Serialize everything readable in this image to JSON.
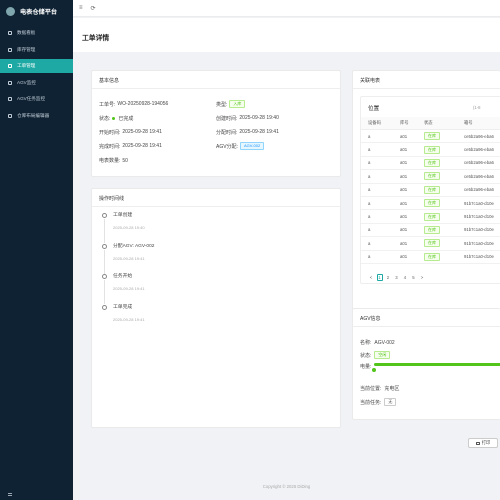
{
  "app": {
    "title": "电表仓储平台"
  },
  "sidebar": {
    "items": [
      {
        "label": "数据看板",
        "icon": "dashboard-icon",
        "active": false
      },
      {
        "label": "库存管理",
        "icon": "inventory-icon",
        "active": false
      },
      {
        "label": "工单管理",
        "icon": "workorder-icon",
        "active": true
      },
      {
        "label": "AGV监控",
        "icon": "agv-icon",
        "active": false
      },
      {
        "label": "AGV任务监控",
        "icon": "task-icon",
        "active": false
      },
      {
        "label": "仓库布局编辑器",
        "icon": "layout-icon",
        "active": false
      }
    ]
  },
  "topbar": {
    "menu_icon": "≡",
    "refresh_icon": "⟳"
  },
  "page": {
    "title": "工单详情"
  },
  "basic_info": {
    "title": "基本信息",
    "order_no_label": "工单号:",
    "order_no": "WO-20250928-194056",
    "type_label": "类型:",
    "type": "入库",
    "status_label": "状态:",
    "status": "已完成",
    "created_label": "创建时间:",
    "created": "2025-09-28 19:40",
    "start_label": "开始时间:",
    "start": "2025-09-28 19:41",
    "assign_label": "分配时间:",
    "assign": "2025-09-28 19:41",
    "finish_label": "完成时间:",
    "finish": "2025-09-28 19:41",
    "agv_label": "AGV分配:",
    "agv": "AGV-002",
    "qty_label": "电表数量:",
    "qty": "50"
  },
  "operation_log": {
    "title": "操作时间线",
    "items": [
      {
        "title": "工单创建",
        "time": "2025-09-28 19:40"
      },
      {
        "title": "分配AGV: AGV-002",
        "time": "2025-09-28 19:41"
      },
      {
        "title": "任务开始",
        "time": "2025-09-28 19:41"
      },
      {
        "title": "工单完成",
        "time": "2025-09-28 19:41"
      }
    ]
  },
  "meters": {
    "title": "关联电表",
    "inner_title": "位置",
    "inner_extra": "(1-8",
    "columns": [
      "设备码",
      "库号",
      "状态",
      "箱号"
    ],
    "rows": [
      {
        "col1": "a",
        "col2": "a01",
        "status": "在库",
        "col4": "ce5b2a96-eba6"
      },
      {
        "col1": "a",
        "col2": "a01",
        "status": "在库",
        "col4": "ce5b2a96-eba6"
      },
      {
        "col1": "a",
        "col2": "a01",
        "status": "在库",
        "col4": "ce5b2a96-eba6"
      },
      {
        "col1": "a",
        "col2": "a01",
        "status": "在库",
        "col4": "ce5b2a96-eba6"
      },
      {
        "col1": "a",
        "col2": "a01",
        "status": "在库",
        "col4": "ce5b2a96-eba6"
      },
      {
        "col1": "a",
        "col2": "a01",
        "status": "在库",
        "col4": "91b7c1a0-d10e"
      },
      {
        "col1": "a",
        "col2": "a01",
        "status": "在库",
        "col4": "91b7c1a0-d10e"
      },
      {
        "col1": "a",
        "col2": "a01",
        "status": "在库",
        "col4": "91b7c1a0-d10e"
      },
      {
        "col1": "a",
        "col2": "a01",
        "status": "在库",
        "col4": "91b7c1a0-d10e"
      },
      {
        "col1": "a",
        "col2": "a01",
        "status": "在库",
        "col4": "91b7c1a0-d10e"
      }
    ],
    "pagination": {
      "prev": "<",
      "pages": [
        "1",
        "2",
        "3",
        "4",
        "5"
      ],
      "next": ">"
    }
  },
  "agv_info": {
    "title": "AGV信息",
    "name_label": "名称:",
    "name": "AGV-002",
    "status_label": "状态:",
    "status": "空闲",
    "battery_label": "电量:",
    "battery_fraction": 1.0,
    "position_label": "当前位置:",
    "position": "充电区",
    "task_label": "当前任务:",
    "task": "无"
  },
  "actions": {
    "print_label": "打印"
  },
  "footer": {
    "text": "Copyright © 2025 DiDing"
  },
  "colors": {
    "sidebar_bg": "#0e2233",
    "accent": "#1fa9a4",
    "success": "#52c41a",
    "info": "#1890ff"
  }
}
